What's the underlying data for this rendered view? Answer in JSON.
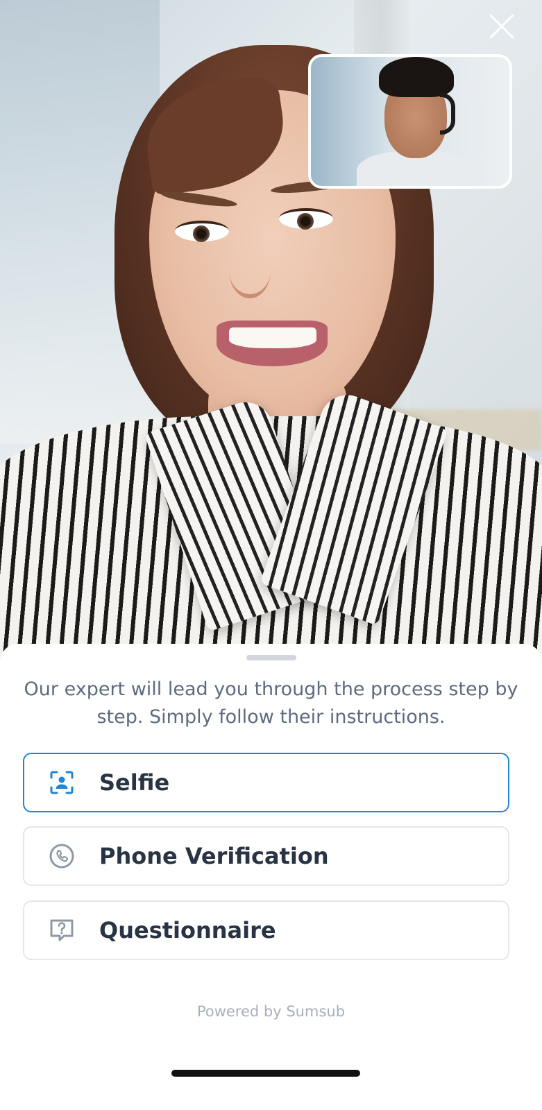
{
  "video": {
    "close_icon": "close-icon"
  },
  "sheet": {
    "intro": "Our expert will lead you through the process step by step. Simply follow their instructions.",
    "options": [
      {
        "label": "Selfie",
        "icon": "selfie-icon",
        "active": true
      },
      {
        "label": "Phone Verification",
        "icon": "phone-icon",
        "active": false
      },
      {
        "label": "Questionnaire",
        "icon": "questionnaire-icon",
        "active": false
      }
    ],
    "powered_by": "Powered by Sumsub"
  },
  "colors": {
    "accent": "#1f86d6",
    "text_primary": "#283344",
    "text_secondary": "#5c6b80",
    "muted": "#a7afba"
  }
}
